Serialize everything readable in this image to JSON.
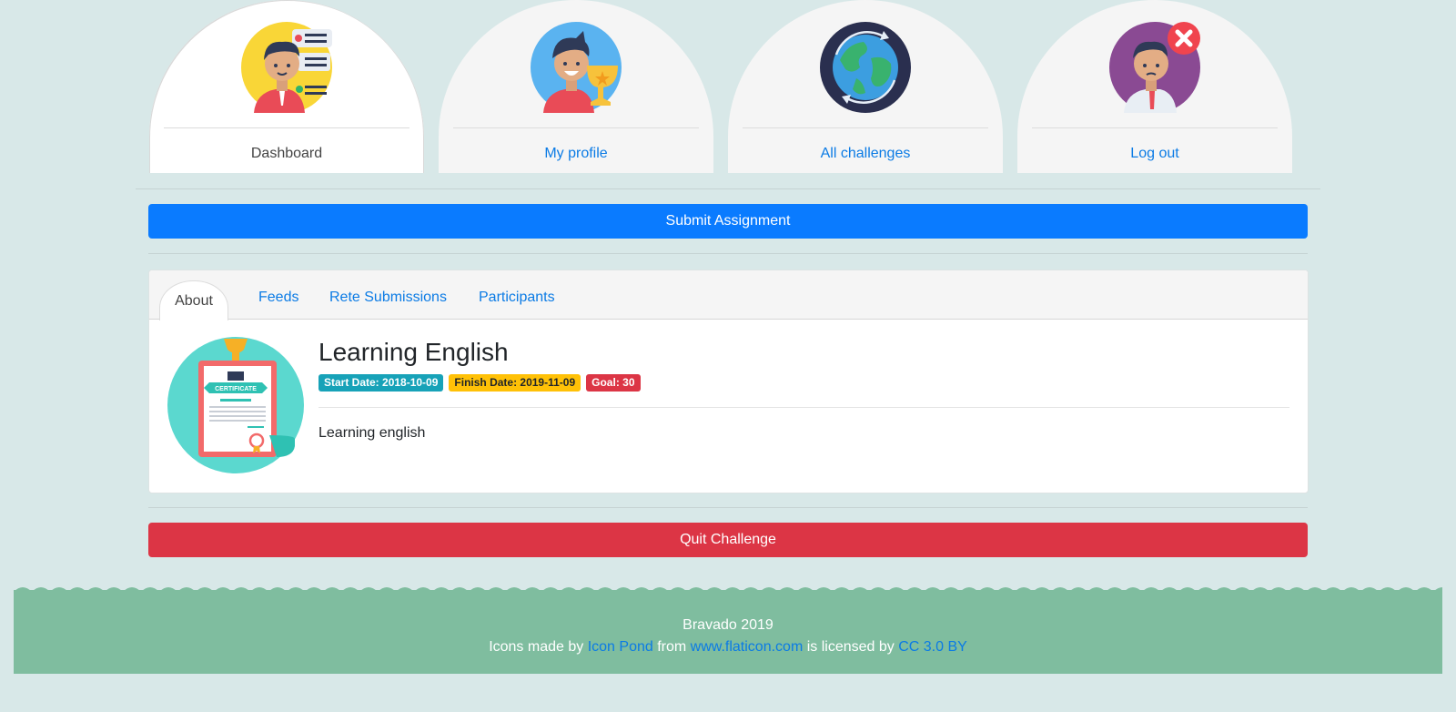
{
  "nav": {
    "items": [
      {
        "label": "Dashboard",
        "icon": "dashboard-avatar-icon"
      },
      {
        "label": "My profile",
        "icon": "profile-trophy-avatar-icon"
      },
      {
        "label": "All challenges",
        "icon": "globe-icon"
      },
      {
        "label": "Log out",
        "icon": "logout-avatar-icon"
      }
    ],
    "active": "Dashboard"
  },
  "actions": {
    "submit_label": "Submit Assignment",
    "quit_label": "Quit Challenge"
  },
  "challenge": {
    "tabs": [
      "About",
      "Feeds",
      "Rete Submissions",
      "Participants"
    ],
    "active_tab": "About",
    "icon": "certificate-icon",
    "title": "Learning English",
    "start_badge": "Start Date: 2018-10-09",
    "finish_badge": "Finish Date: 2019-11-09",
    "goal_badge": "Goal: 30",
    "description": "Learning english"
  },
  "footer": {
    "copyright": "Bravado 2019",
    "credit_prefix": "Icons made by",
    "author": "Icon Pond",
    "from": "from",
    "site": "www.flaticon.com",
    "license_prefix": "is licensed by",
    "license": "CC 3.0 BY"
  },
  "colors": {
    "background": "#d8e8e8",
    "primary": "#0a7bff",
    "danger": "#dc3545",
    "info": "#17a2b8",
    "warning": "#ffc107",
    "footer": "#7fbd9f"
  }
}
